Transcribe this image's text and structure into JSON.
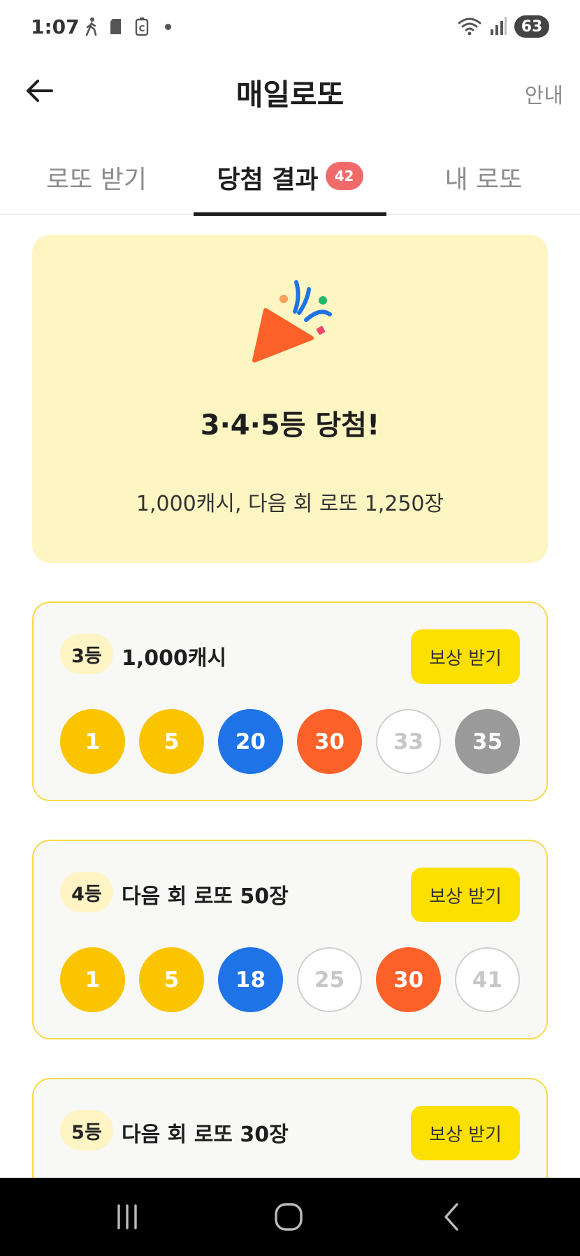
{
  "status_bar": {
    "time": "1:07",
    "battery": "63",
    "icons": [
      "walk-icon",
      "sd-card-icon",
      "battery-saver-icon",
      "wifi-icon",
      "signal-icon"
    ]
  },
  "header": {
    "title": "매일로또",
    "guide_label": "안내"
  },
  "tabs": [
    {
      "label": "로또 받기"
    },
    {
      "label": "당첨 결과",
      "badge": "42",
      "active": true
    },
    {
      "label": "내 로또"
    }
  ],
  "banner": {
    "title": "3·4·5등 당첨!",
    "description": "1,000캐시, 다음 회 로또 1,250장"
  },
  "prizes": [
    {
      "rank": "3등",
      "reward": "1,000캐시",
      "button": "보상 받기",
      "balls": [
        {
          "number": "1",
          "color": "yellow"
        },
        {
          "number": "5",
          "color": "yellow"
        },
        {
          "number": "20",
          "color": "blue"
        },
        {
          "number": "30",
          "color": "red"
        },
        {
          "number": "33",
          "color": "white"
        },
        {
          "number": "35",
          "color": "gray"
        }
      ]
    },
    {
      "rank": "4등",
      "reward": "다음 회 로또 50장",
      "button": "보상 받기",
      "balls": [
        {
          "number": "1",
          "color": "yellow"
        },
        {
          "number": "5",
          "color": "yellow"
        },
        {
          "number": "18",
          "color": "blue"
        },
        {
          "number": "25",
          "color": "white"
        },
        {
          "number": "30",
          "color": "red"
        },
        {
          "number": "41",
          "color": "white"
        }
      ]
    },
    {
      "rank": "5등",
      "reward": "다음 회 로또 30장",
      "button": "보상 받기"
    }
  ],
  "colors": {
    "accent_yellow": "#fce000",
    "banner_bg": "#fdf6c3",
    "card_border": "#f8d94a",
    "badge_red": "#f06a6a",
    "ball_yellow": "#fbc400",
    "ball_blue": "#1e73e6",
    "ball_red": "#fb6128",
    "ball_gray": "#9a9a9a"
  }
}
